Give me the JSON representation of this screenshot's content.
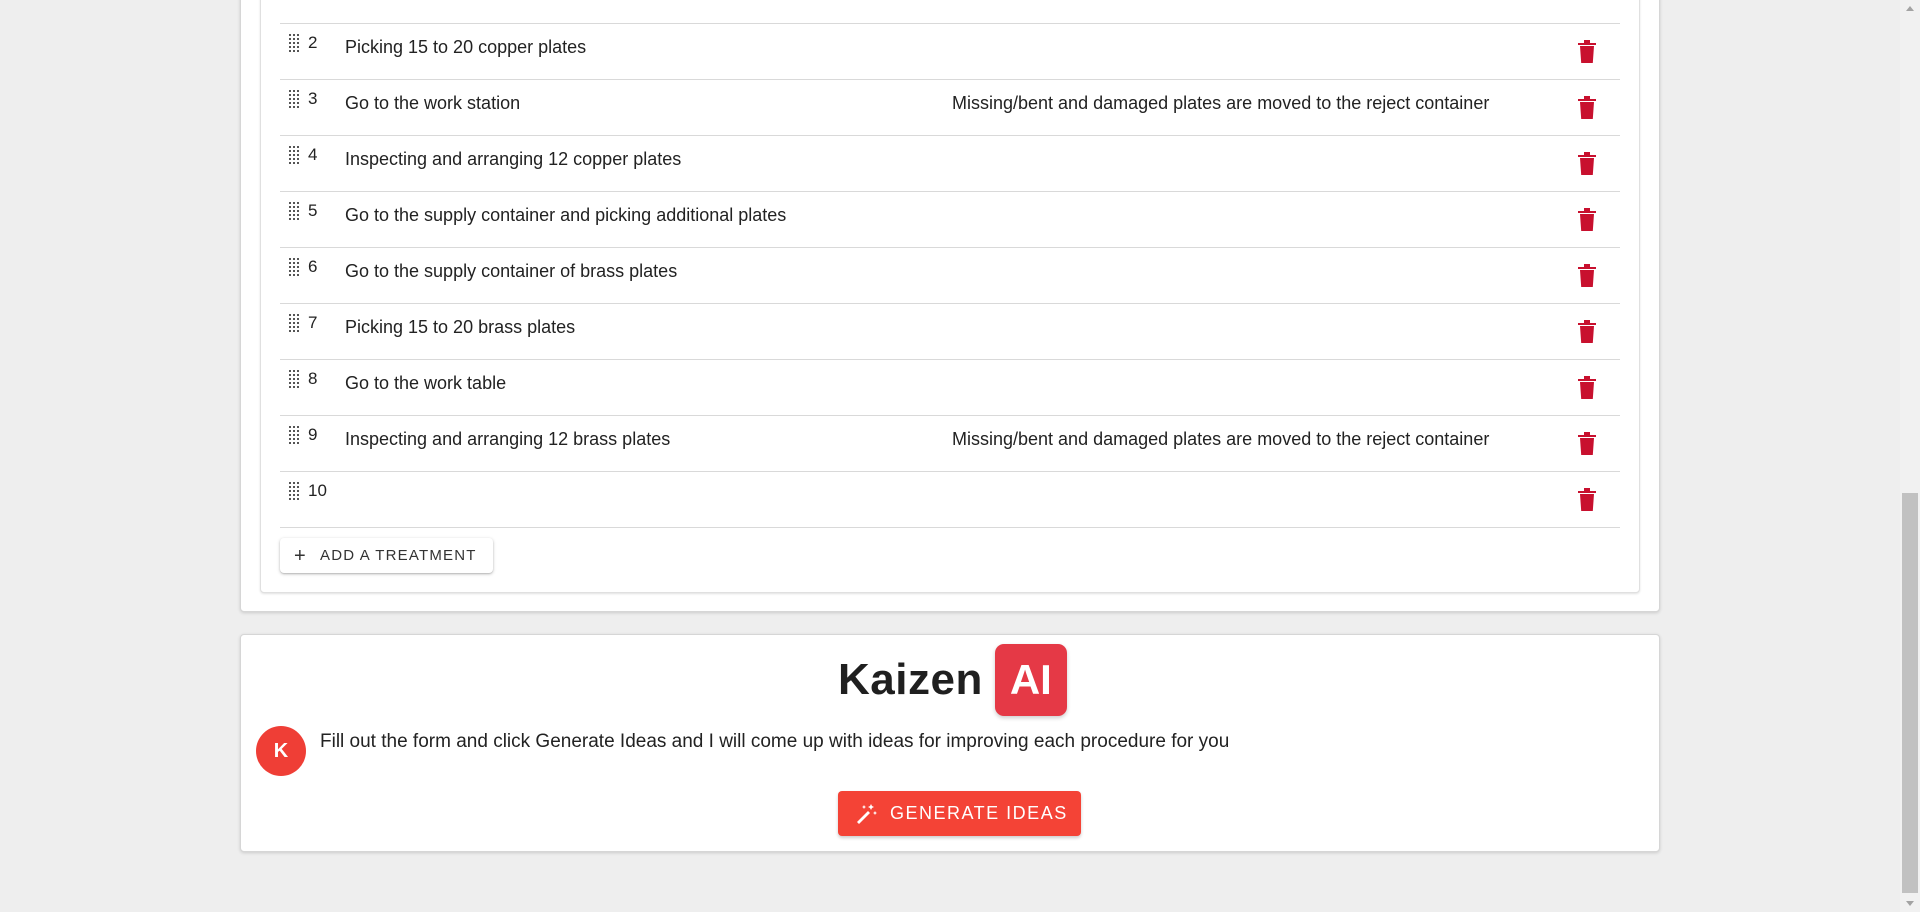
{
  "treatments": {
    "rows": [
      {
        "num": "2",
        "name": "Picking 15 to 20 copper plates",
        "note": ""
      },
      {
        "num": "3",
        "name": "Go to the work station",
        "note": "Missing/bent and damaged plates are moved to the reject container"
      },
      {
        "num": "4",
        "name": "Inspecting and arranging 12 copper plates",
        "note": ""
      },
      {
        "num": "5",
        "name": "Go to the supply container and picking additional plates",
        "note": ""
      },
      {
        "num": "6",
        "name": "Go to the supply container of brass plates",
        "note": ""
      },
      {
        "num": "7",
        "name": "Picking 15 to 20 brass plates",
        "note": ""
      },
      {
        "num": "8",
        "name": "Go to the work table",
        "note": ""
      },
      {
        "num": "9",
        "name": "Inspecting and arranging 12 brass plates",
        "note": "Missing/bent and damaged plates are moved to the reject container"
      },
      {
        "num": "10",
        "name": "",
        "note": ""
      }
    ],
    "add_button_label": "ADD A TREATMENT",
    "add_icon": "plus-icon",
    "drag_icon": "drag-handle-icon",
    "delete_icon": "trash-icon",
    "delete_color": "#c8102e"
  },
  "ai": {
    "brand_text": "Kaizen",
    "brand_badge": "AI",
    "brand_color": "#e53946",
    "avatar_letter": "K",
    "message": "Fill out the form and click Generate Ideas and I will come up with ideas for improving each procedure for you",
    "generate_button_label": "GENERATE IDEAS",
    "generate_icon": "magic-wand-icon",
    "button_color": "#f44336"
  }
}
